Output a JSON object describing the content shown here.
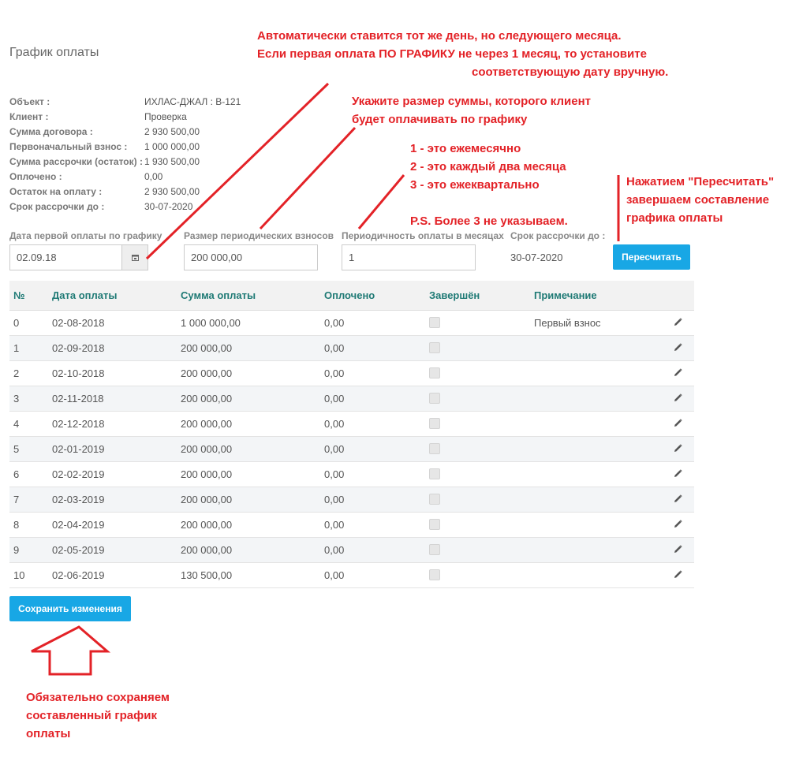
{
  "page": {
    "title": "График оплаты"
  },
  "info": [
    {
      "label": "Объект :",
      "value": "ИХЛАС-ДЖАЛ : В-121"
    },
    {
      "label": "Клиент :",
      "value": "Проверка"
    },
    {
      "label": "Сумма договора :",
      "value": "2 930 500,00"
    },
    {
      "label": "Первоначальный взнос :",
      "value": "1 000 000,00"
    },
    {
      "label": "Сумма рассрочки (остаток) :",
      "value": "1 930 500,00"
    },
    {
      "label": "Оплочено :",
      "value": "0,00"
    },
    {
      "label": "Остаток на оплату :",
      "value": "2 930 500,00"
    },
    {
      "label": "Срок рассрочки до :",
      "value": "30-07-2020"
    }
  ],
  "form": {
    "first_payment_label": "Дата первой оплаты по графику",
    "first_payment_value": "02.09.18",
    "periodic_label": "Размер периодических взносов",
    "periodic_value": "200 000,00",
    "frequency_label": "Периодичность оплаты в месяцах",
    "frequency_value": "1",
    "term_label": "Срок рассрочки до :",
    "term_value": "30-07-2020",
    "recalc_label": "Пересчитать"
  },
  "table": {
    "headers": [
      "№",
      "Дата оплаты",
      "Сумма оплаты",
      "Оплочено",
      "Завершён",
      "Примечание"
    ],
    "rows": [
      {
        "n": "0",
        "date": "02-08-2018",
        "amount": "1 000 000,00",
        "paid": "0,00",
        "done": false,
        "note": "Первый взнос"
      },
      {
        "n": "1",
        "date": "02-09-2018",
        "amount": "200 000,00",
        "paid": "0,00",
        "done": false,
        "note": ""
      },
      {
        "n": "2",
        "date": "02-10-2018",
        "amount": "200 000,00",
        "paid": "0,00",
        "done": false,
        "note": ""
      },
      {
        "n": "3",
        "date": "02-11-2018",
        "amount": "200 000,00",
        "paid": "0,00",
        "done": false,
        "note": ""
      },
      {
        "n": "4",
        "date": "02-12-2018",
        "amount": "200 000,00",
        "paid": "0,00",
        "done": false,
        "note": ""
      },
      {
        "n": "5",
        "date": "02-01-2019",
        "amount": "200 000,00",
        "paid": "0,00",
        "done": false,
        "note": ""
      },
      {
        "n": "6",
        "date": "02-02-2019",
        "amount": "200 000,00",
        "paid": "0,00",
        "done": false,
        "note": ""
      },
      {
        "n": "7",
        "date": "02-03-2019",
        "amount": "200 000,00",
        "paid": "0,00",
        "done": false,
        "note": ""
      },
      {
        "n": "8",
        "date": "02-04-2019",
        "amount": "200 000,00",
        "paid": "0,00",
        "done": false,
        "note": ""
      },
      {
        "n": "9",
        "date": "02-05-2019",
        "amount": "200 000,00",
        "paid": "0,00",
        "done": false,
        "note": ""
      },
      {
        "n": "10",
        "date": "02-06-2019",
        "amount": "130 500,00",
        "paid": "0,00",
        "done": false,
        "note": ""
      }
    ]
  },
  "save_label": "Сохранить изменения",
  "annotations": {
    "auto_date": [
      "Автоматически ставится тот же день, но следующего месяца.",
      "Если первая оплата ПО ГРАФИКУ не через 1 месяц, то установите",
      "соответствующую дату вручную."
    ],
    "amount": [
      "Укажите размер суммы, которого клиент",
      "будет оплачивать по графику"
    ],
    "frequency": [
      "1 - это ежемесячно",
      "2 - это каждый два месяца",
      "3 - это ежеквартально"
    ],
    "ps": "P.S. Более 3 не указываем.",
    "recalc": [
      "Нажатием \"Пересчитать\"",
      "завершаем составление",
      "графика оплаты"
    ],
    "save": [
      "Обязательно сохраняем",
      "составленный график",
      "оплаты"
    ]
  },
  "colors": {
    "accent": "#18a7e5",
    "annotation": "#e32227",
    "header_text": "#1f7a75"
  },
  "icons": {
    "calendar": "calendar-icon",
    "edit": "pencil-icon"
  }
}
